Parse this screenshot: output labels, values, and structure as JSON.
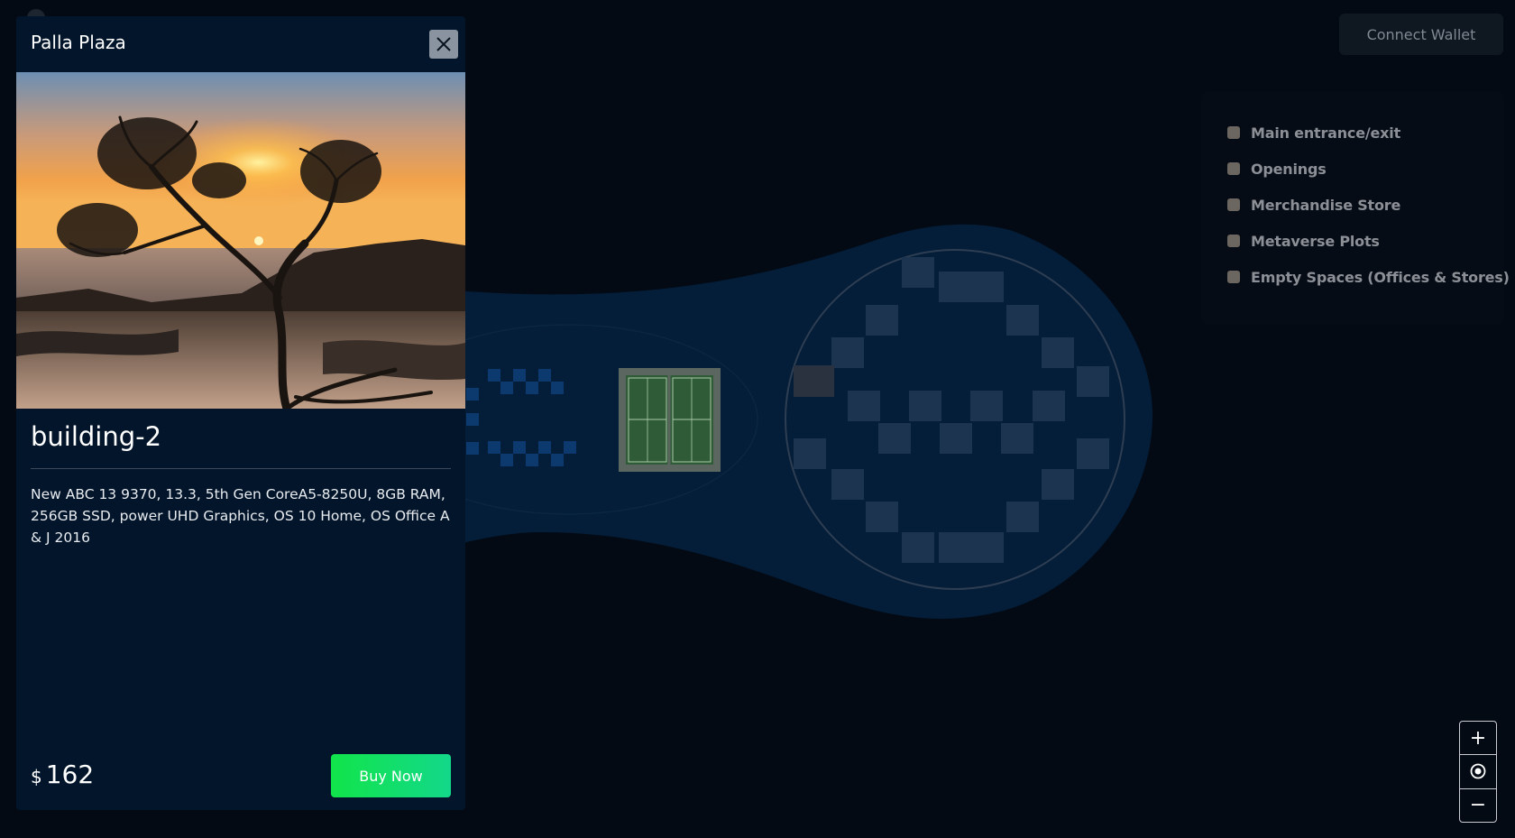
{
  "header": {
    "connect_wallet_label": "Connect Wallet"
  },
  "legend": {
    "items": [
      {
        "label": "Main entrance/exit"
      },
      {
        "label": "Openings"
      },
      {
        "label": "Merchandise Store"
      },
      {
        "label": "Metaverse Plots"
      },
      {
        "label": "Empty Spaces (Offices & Stores)"
      }
    ]
  },
  "zoom": {
    "zoom_in_label": "+",
    "zoom_out_label": "−"
  },
  "panel": {
    "title": "Palla Plaza",
    "building_name": "building-2",
    "description": "New ABC 13 9370, 13.3, 5th Gen CoreA5-8250U, 8GB RAM, 256GB SSD, power UHD Graphics, OS 10 Home, OS Office A & J 2016",
    "currency": "$",
    "price": "162",
    "buy_label": "Buy Now"
  },
  "colors": {
    "background": "#030a14",
    "map_body": "#041d38",
    "plot": "#1d3450",
    "panel": "#03152a",
    "buy_button": "#11e44a",
    "legend_swatch": "#6b665f"
  }
}
